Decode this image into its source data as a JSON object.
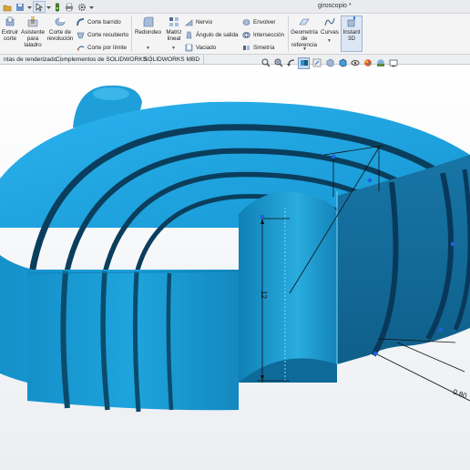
{
  "window": {
    "title": "giroscopio *"
  },
  "ribbon": {
    "extruir_corte": "Extruir\ncorte",
    "asistente_taladro": "Asistente\npara\ntaladro",
    "corte_revolucion": "Corte de\nrevolución",
    "corte_barrido": "Corte barrido",
    "corte_recubierto": "Corte recubierto",
    "corte_limite": "Corte por límite",
    "redondeo": "Redondeo",
    "matriz_lineal": "Matriz\nlineal",
    "nervio": "Nervio",
    "angulo_salida": "Ángulo de salida",
    "vaciado": "Vaciado",
    "envolver": "Envolver",
    "interseccion": "Intersección",
    "simetria": "Simetría",
    "geometria_referencia": "Geometría\nde\nreferencia",
    "curvas": "Curvas",
    "instant3d": "Instant\n3D"
  },
  "tabs": [
    {
      "label": "ntas de renderizado"
    },
    {
      "label": "Complementos de SOLIDWORKS"
    },
    {
      "label": "SOLIDWORKS MBD"
    }
  ],
  "dimensions": [
    {
      "value": "12"
    },
    {
      "value": "0.80"
    }
  ],
  "colors": {
    "part_blue": "#1a9ad6",
    "part_dark": "#0b5f88",
    "ribbon_bg": "#f4f4f5",
    "selection": "#1e63d9"
  }
}
